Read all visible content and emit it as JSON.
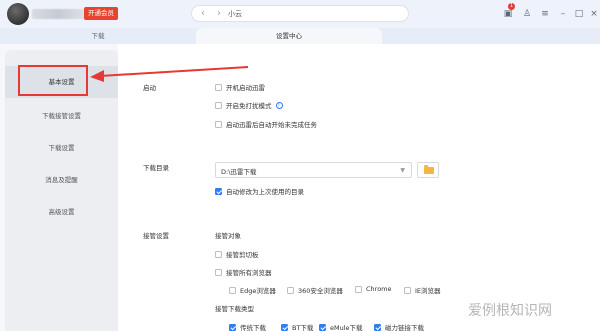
{
  "titlebar": {
    "vip_label": "开通会员",
    "search_text": "小云",
    "icons": [
      "box-icon",
      "shirt-icon",
      "menu-icon",
      "minimize-icon",
      "maximize-icon",
      "close-icon"
    ],
    "notification_count": "1"
  },
  "tabs": [
    {
      "label": "下载"
    },
    {
      "label": "设置中心"
    }
  ],
  "sidebar": {
    "items": [
      {
        "label": "基本设置"
      },
      {
        "label": "下载接管设置"
      },
      {
        "label": "下载设置"
      },
      {
        "label": "消息及提醒"
      },
      {
        "label": "高级设置"
      }
    ]
  },
  "main": {
    "startup": {
      "label": "启动",
      "options": [
        {
          "label": "开机启动迅雷",
          "checked": false
        },
        {
          "label": "开启免打扰模式",
          "checked": false
        },
        {
          "label": "启动迅雷后自动开始未完成任务",
          "checked": false
        }
      ]
    },
    "download_dir": {
      "label": "下载目录",
      "value": "D:\\迅雷下载",
      "auto_modify": {
        "label": "自动修改为上次使用的目录",
        "checked": true
      }
    },
    "takeover": {
      "label": "接管设置",
      "target_label": "接管对象",
      "options": [
        {
          "label": "接管剪切板",
          "checked": false
        },
        {
          "label": "接管所有浏览器",
          "checked": false
        }
      ],
      "browsers": [
        {
          "label": "Edge浏览器",
          "checked": false
        },
        {
          "label": "360安全浏览器",
          "checked": false
        },
        {
          "label": "Chrome",
          "checked": false
        },
        {
          "label": "IE浏览器",
          "checked": false
        }
      ],
      "type_label": "接管下载类型",
      "types": [
        {
          "label": "传统下载",
          "checked": true
        },
        {
          "label": "BT下载",
          "checked": true
        },
        {
          "label": "eMule下载",
          "checked": true
        },
        {
          "label": "磁力链接下载",
          "checked": true
        }
      ]
    }
  },
  "watermark": "爱例根知识网",
  "colors": {
    "accent": "#2f7cf6",
    "highlight": "#e53935",
    "vip": "#e7432f"
  }
}
